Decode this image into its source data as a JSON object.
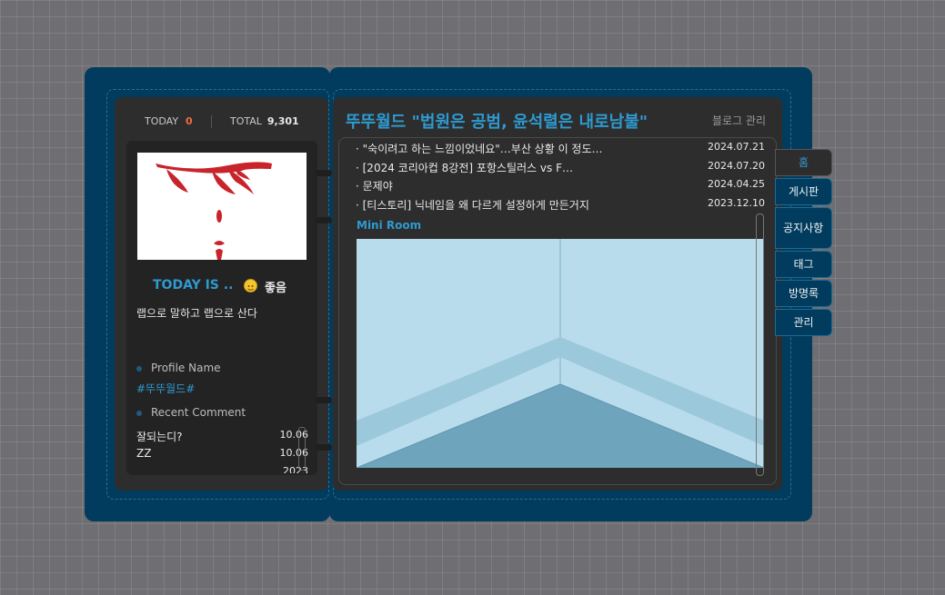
{
  "counter": {
    "today_label": "TODAY",
    "today_value": "0",
    "total_label": "TOTAL",
    "total_value": "9,301"
  },
  "profile": {
    "today_is": "TODAY IS ..",
    "mood": "좋음",
    "status_message": "랩으로 말하고 랩으로 산다",
    "profile_name_label": "Profile Name",
    "profile_name": "#뚜뚜월드#",
    "recent_comment_label": "Recent Comment",
    "comments": [
      {
        "text": "잘되는디?",
        "date": "10.06"
      },
      {
        "text": "ZZ",
        "date": "10.06"
      },
      {
        "text": "",
        "date": "2023"
      }
    ]
  },
  "header": {
    "title": "뚜뚜월드 \"법원은 공범, 윤석렬은 내로남불\"",
    "admin_link": "블로그 관리"
  },
  "posts": [
    {
      "title": "· \"숙이려고 하는 느낌이었네요\"…부산 상황 이 정도…",
      "date": "2024.07.21"
    },
    {
      "title": "· [2024 코리아컵 8강전] 포항스틸러스 vs F…",
      "date": "2024.07.20"
    },
    {
      "title": "· 문제야",
      "date": "2024.04.25"
    },
    {
      "title": "· [티스토리] 닉네임을 왜 다르게 설정하게 만든거지",
      "date": "2023.12.10"
    }
  ],
  "mini_room_label": "Mini Room",
  "tabs": [
    "홈",
    "게시판",
    "공지사항",
    "태그",
    "방명록",
    "관리"
  ],
  "colors": {
    "background": "#6f6e73",
    "binder": "#013c5e",
    "panel": "#2d2d2e",
    "accent": "#2e9ad0",
    "today_count": "#f26b3a",
    "room_wall": "#b8dcec",
    "room_floor": "#6fa4bd"
  },
  "icons": {
    "mood": "smiley-face-icon"
  }
}
